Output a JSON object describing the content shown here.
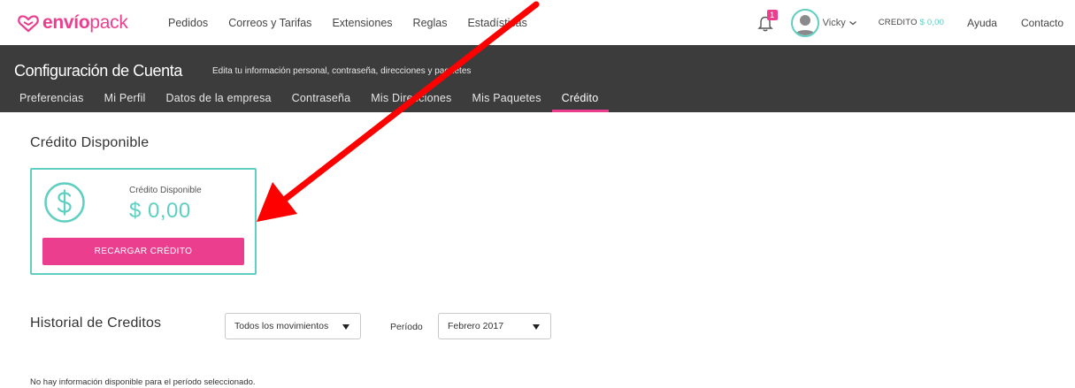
{
  "brand": {
    "part1": "envío",
    "part2": "pack",
    "color": "#ec3e8e"
  },
  "topnav": {
    "links": [
      "Pedidos",
      "Correos y Tarifas",
      "Extensiones",
      "Reglas",
      "Estadísticas"
    ],
    "notifications_count": "1",
    "user_name": "Vicky",
    "credit_label": "CREDITO",
    "credit_amount": "$ 0,00",
    "help": "Ayuda",
    "contact": "Contacto"
  },
  "header": {
    "title": "Configuración de Cuenta",
    "subtitle": "Edita tu información personal, contraseña, direcciones y paquetes",
    "tabs": [
      {
        "label": "Preferencias",
        "active": false
      },
      {
        "label": "Mi Perfil",
        "active": false
      },
      {
        "label": "Datos de la empresa",
        "active": false
      },
      {
        "label": "Contraseña",
        "active": false
      },
      {
        "label": "Mis Direcciones",
        "active": false
      },
      {
        "label": "Mis Paquetes",
        "active": false
      },
      {
        "label": "Crédito",
        "active": true
      }
    ]
  },
  "credit": {
    "section_title": "Crédito Disponible",
    "card_label": "Crédito Disponible",
    "amount": "$ 0,00",
    "button_label": "RECARGAR CRÉDITO"
  },
  "history": {
    "title": "Historial de Creditos",
    "movement_filter": "Todos los movimientos",
    "period_label": "Período",
    "period_value": "Febrero 2017",
    "empty_message": "No hay información disponible para el período seleccionado."
  },
  "colors": {
    "accent": "#ec3e8e",
    "teal": "#5ecfc0",
    "header_bg": "#3c3c3c",
    "annotation": "#ff0000"
  },
  "icons": [
    "envio-pack-logo-icon",
    "bell-icon",
    "avatar-icon",
    "chevron-down-icon",
    "dollar-circle-icon",
    "caret-down-icon",
    "annotation-arrow"
  ]
}
